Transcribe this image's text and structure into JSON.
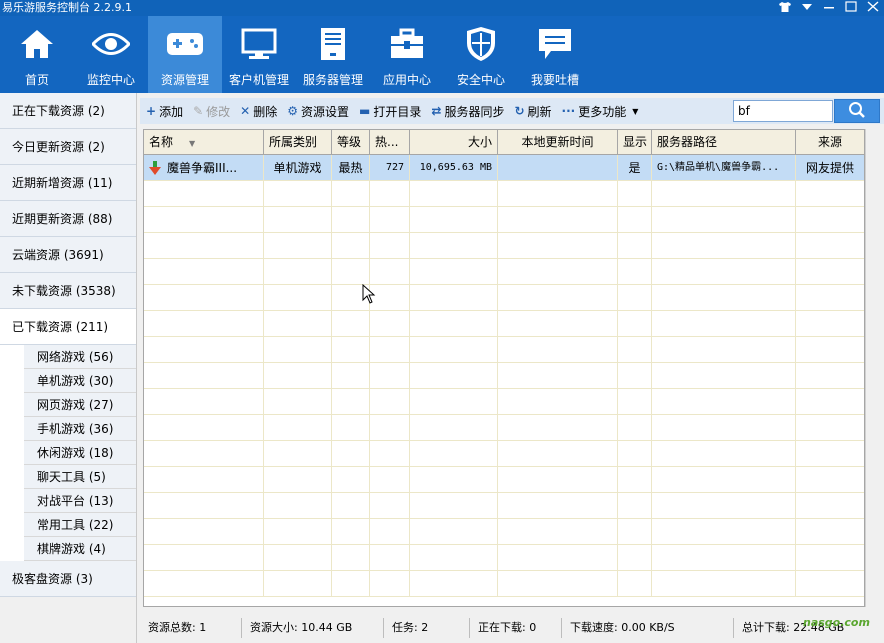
{
  "window": {
    "title": "易乐游服务控制台 2.2.9.1",
    "controls": [
      "shirt-icon",
      "minimize-icon",
      "maximize-icon",
      "close-icon"
    ]
  },
  "nav": [
    {
      "label": "首页",
      "icon": "home-icon",
      "active": false
    },
    {
      "label": "监控中心",
      "icon": "eye-icon",
      "active": false
    },
    {
      "label": "资源管理",
      "icon": "gamepad-icon",
      "active": true
    },
    {
      "label": "客户机管理",
      "icon": "monitor-icon",
      "active": false
    },
    {
      "label": "服务器管理",
      "icon": "server-icon",
      "active": false
    },
    {
      "label": "应用中心",
      "icon": "toolbox-icon",
      "active": false
    },
    {
      "label": "安全中心",
      "icon": "shield-icon",
      "active": false
    },
    {
      "label": "我要吐槽",
      "icon": "chat-icon",
      "active": false
    }
  ],
  "sidebar": {
    "items": [
      {
        "label": "正在下载资源 (2)"
      },
      {
        "label": "今日更新资源 (2)"
      },
      {
        "label": "近期新增资源 (11)"
      },
      {
        "label": "近期更新资源 (88)"
      },
      {
        "label": "云端资源 (3691)"
      },
      {
        "label": "未下载资源 (3538)"
      },
      {
        "label": "已下载资源 (211)"
      }
    ],
    "sub_items": [
      {
        "label": "网络游戏 (56)"
      },
      {
        "label": "单机游戏 (30)"
      },
      {
        "label": "网页游戏 (27)"
      },
      {
        "label": "手机游戏 (36)"
      },
      {
        "label": "休闲游戏 (18)"
      },
      {
        "label": "聊天工具 (5)"
      },
      {
        "label": "对战平台 (13)"
      },
      {
        "label": "常用工具 (22)"
      },
      {
        "label": "棋牌游戏 (4)"
      }
    ],
    "last_item": {
      "label": "极客盘资源 (3)"
    }
  },
  "toolbar": {
    "add": "添加",
    "edit": "修改",
    "delete": "删除",
    "settings": "资源设置",
    "open_dir": "打开目录",
    "sync": "服务器同步",
    "refresh": "刷新",
    "more": "更多功能"
  },
  "search": {
    "value": "bf"
  },
  "grid": {
    "headers": [
      "名称",
      "所属类别",
      "等级",
      "热...",
      "大小",
      "本地更新时间",
      "显示",
      "服务器路径",
      "来源"
    ],
    "rows": [
      {
        "name": "魔兽争霸III...",
        "category": "单机游戏",
        "level": "最热",
        "heat": "727",
        "size": "10,695.63 MB",
        "updated": "",
        "show": "是",
        "path": "G:\\精品单机\\魔兽争霸...",
        "source": "网友提供"
      }
    ]
  },
  "status": {
    "total": "资源总数: 1",
    "size": "资源大小: 10.44 GB",
    "tasks": "任务: 2",
    "downloading": "正在下载: 0",
    "speed": "下载速度: 0.00 KB/S",
    "total_dl": "总计下载: 22.48 GB"
  },
  "colors": {
    "nav_bg": "#1366c0",
    "nav_active": "#3c8ad8",
    "row_selected": "#c3dcf5",
    "header_bg": "#f3efe0"
  }
}
